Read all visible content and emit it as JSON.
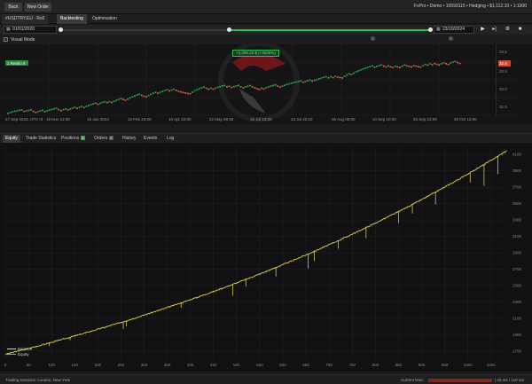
{
  "topbar": {
    "back_label": "Back",
    "new_order_label": "New Order",
    "account_info": "FxPro • Demo • 10593115 • Hedging • $1,112.10 • 1:1000"
  },
  "tabs": [
    {
      "label": "#USDTRY.EU · Rs5"
    },
    {
      "label": "Backtesting"
    },
    {
      "label": "Optimisation"
    }
  ],
  "range": {
    "start_date": "01/01/2020",
    "end_date": "23/10/2024",
    "start_fraction": 0.0,
    "mid_fraction": 0.455,
    "end_fraction": 1.0
  },
  "visual_mode_label": "Visual Mode",
  "price_chart": {
    "position_label": "1 Renko 5",
    "profit_label": "+3,206.22 $ (+3225%)",
    "time_labels": [
      "27 Sep 2023, UTC+0",
      "19 Nov 12:30",
      "15 Jan 2024",
      "13 Feb 23:00",
      "10 Apr 22:00",
      "22 May 00:30",
      "15 Jul 12:00",
      "23 Jul 20:10",
      "06 Aug 00:00",
      "10 Sep 10:00",
      "25 Sep 13:05",
      "29 Oct 12:00"
    ],
    "price_labels": [
      "33.5",
      "32.5",
      "32.0",
      "31.5"
    ],
    "current_price": "32.4"
  },
  "bottom_tabs": [
    {
      "label": "Equity"
    },
    {
      "label": "Trade Statistics"
    },
    {
      "label": "Positions",
      "badge": "2"
    },
    {
      "label": "Orders",
      "badge": "0"
    },
    {
      "label": "History"
    },
    {
      "label": "Events"
    },
    {
      "label": "Log"
    }
  ],
  "chart_data": {
    "type": "line",
    "series": [
      {
        "name": "Balance",
        "color": "#f2e34a"
      },
      {
        "name": "Equity",
        "color": "#9a9a9a"
      }
    ],
    "x_ticks": [
      0,
      50,
      100,
      150,
      200,
      250,
      300,
      350,
      400,
      450,
      500,
      550,
      600,
      650,
      700,
      750,
      800,
      850,
      900,
      950,
      1000,
      1050
    ],
    "y_ticks": [
      1700,
      1900,
      2100,
      2300,
      2500,
      2700,
      2900,
      3100,
      3300,
      3500,
      3700,
      3900,
      4100
    ],
    "xlim": [
      0,
      1085
    ],
    "ylim": [
      1600,
      4200
    ],
    "balance_start": 1660,
    "balance_end": 4150,
    "grid": true,
    "legend": "bottom-left"
  },
  "status": {
    "left": "Trading sessions: London, New York",
    "time_label": "Current time:",
    "right": "| 43 ms / 110 ms"
  },
  "colors": {
    "accent_green": "#2fbf4f",
    "equity_yellow": "#f2e34a",
    "renko_up": "#29a347",
    "renko_down": "#e25a45"
  }
}
